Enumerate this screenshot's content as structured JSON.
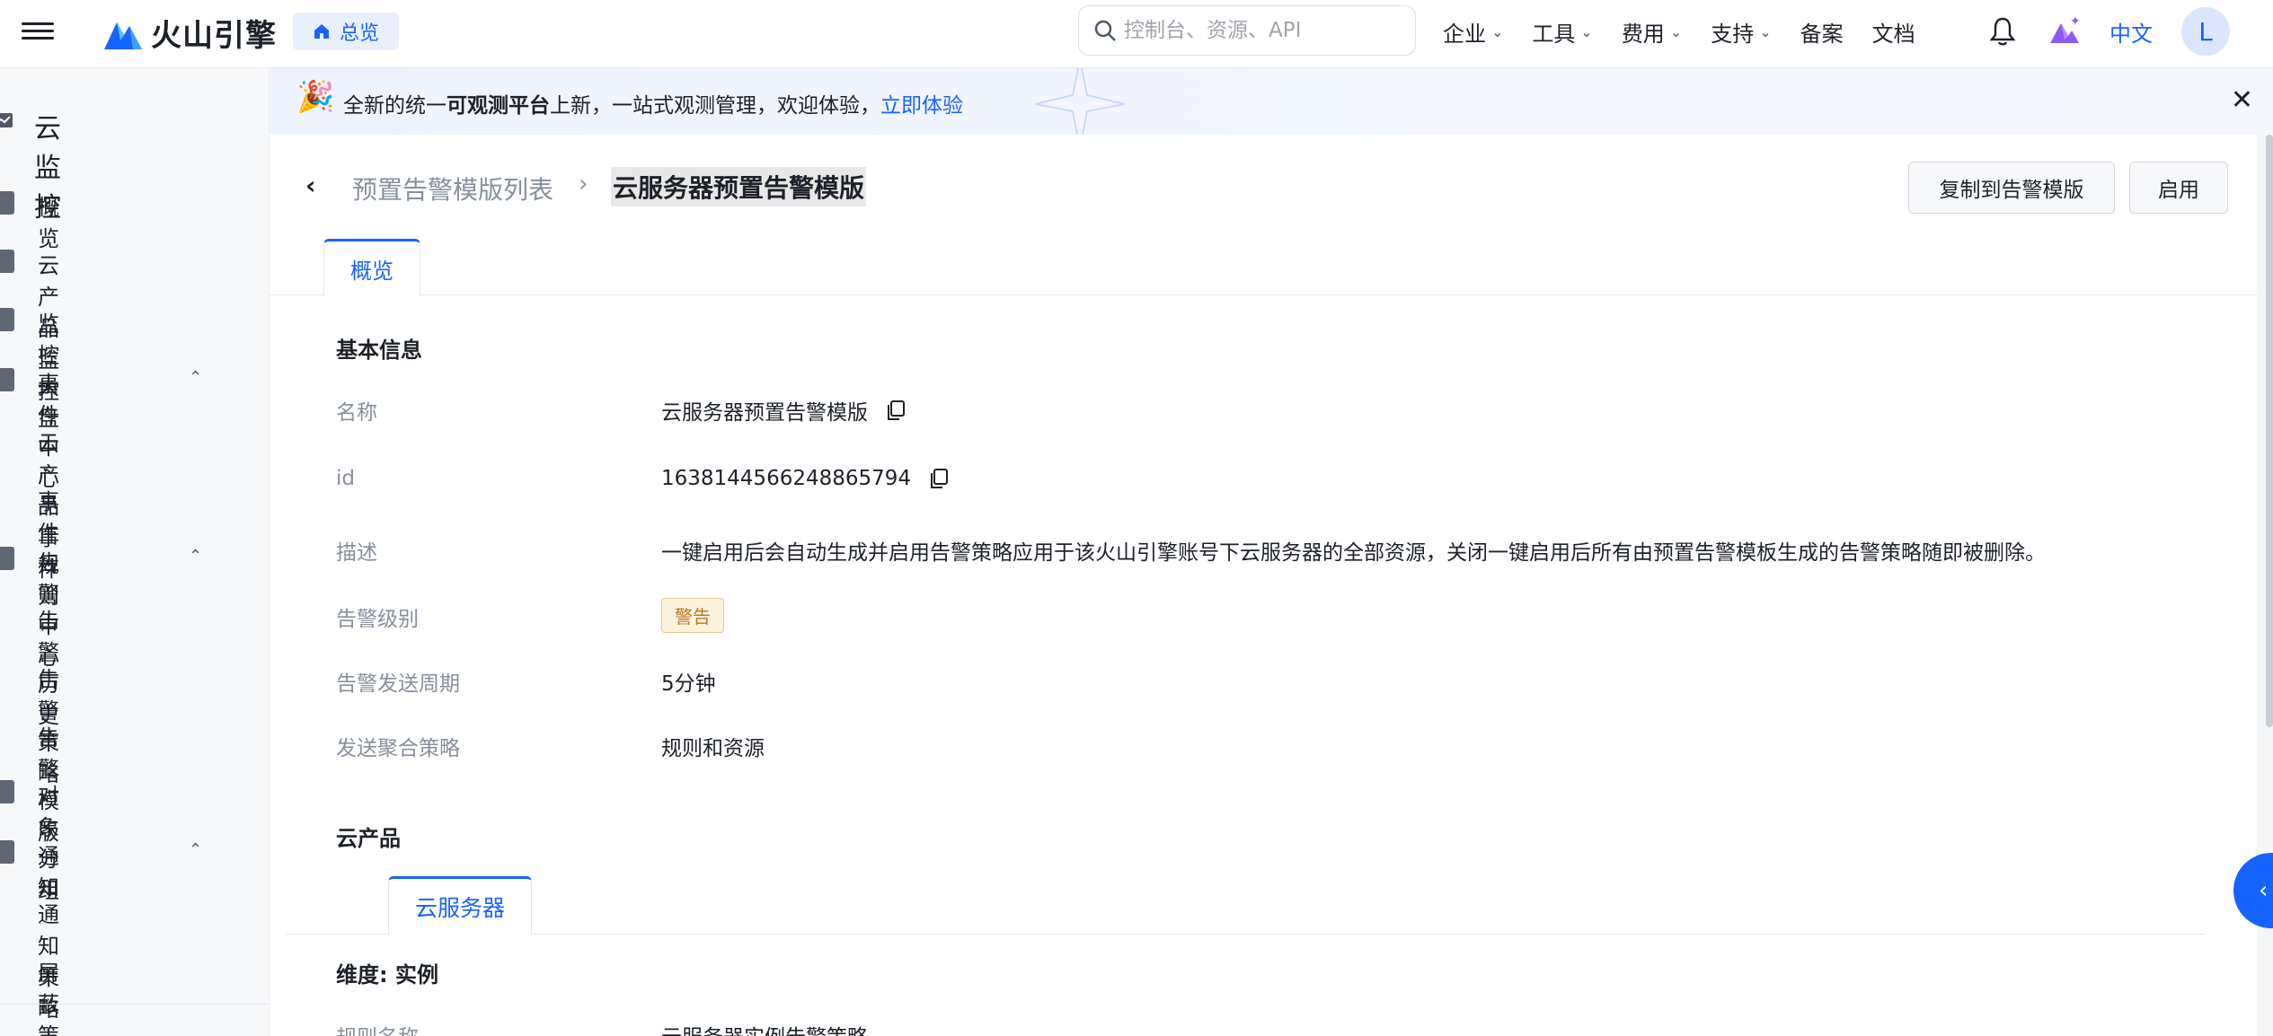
{
  "topnav": {
    "brand": "火山引擎",
    "home_pill": "总览",
    "search_placeholder": "控制台、资源、API",
    "menu": [
      "企业",
      "工具",
      "费用",
      "支持"
    ],
    "links": [
      "备案",
      "文档"
    ],
    "lang": "中文",
    "avatar_letter": "L"
  },
  "sidebar": {
    "title": "云监控",
    "items": [
      {
        "label": "概览"
      },
      {
        "label": "云产品监控"
      },
      {
        "label": "监控大盘"
      },
      {
        "label": "事件中心"
      },
      {
        "label": "云产品事件"
      },
      {
        "label": "事件规则"
      },
      {
        "label": "告警中心"
      },
      {
        "label": "告警历史"
      },
      {
        "label": "告警策略"
      },
      {
        "label": "告警模版"
      },
      {
        "label": "对象分组"
      },
      {
        "label": "通知"
      },
      {
        "label": "通知策略"
      },
      {
        "label": "屏蔽策略"
      }
    ]
  },
  "banner": {
    "prefix": "全新的统一",
    "bold": "可观测平台",
    "suffix": "上新，一站式观测管理，欢迎体验，",
    "link": "立即体验"
  },
  "header": {
    "breadcrumb_parent": "预置告警模版列表",
    "breadcrumb_sep": "›",
    "breadcrumb_current": "云服务器预置告警模版",
    "btn_copy": "复制到告警模版",
    "btn_enable": "启用"
  },
  "tabs": {
    "overview": "概览"
  },
  "basic": {
    "title": "基本信息",
    "fields": [
      {
        "label": "名称",
        "value": "云服务器预置告警模版"
      },
      {
        "label": "id",
        "value": "1638144566248865794"
      },
      {
        "label": "描述",
        "value": "一键启用后会自动生成并启用告警策略应用于该火山引擎账号下云服务器的全部资源，关闭一键启用后所有由预置告警模板生成的告警策略随即被删除。"
      },
      {
        "label": "告警级别",
        "value": "警告"
      },
      {
        "label": "告警发送周期",
        "value": "5分钟"
      },
      {
        "label": "发送聚合策略",
        "value": "规则和资源"
      }
    ]
  },
  "product": {
    "title": "云产品",
    "subtab": "云服务器",
    "dimension": "维度: 实例",
    "rule_label": "规则名称",
    "rule_value": "云服务器实例告警策略"
  },
  "colors": {
    "accent": "#1664ff",
    "warning_tag": "#b7791f"
  }
}
